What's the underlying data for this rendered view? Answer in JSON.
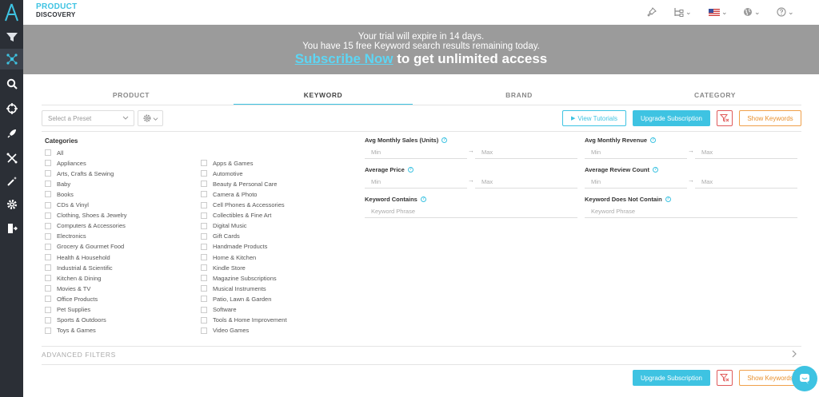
{
  "brand": {
    "line1": "PRODUCT",
    "line2": "DISCOVERY"
  },
  "banner": {
    "line1": "Your trial will expire in 14 days.",
    "line2": "You have 15 free Keyword search results remaining today.",
    "subscribe_link": "Subscribe Now",
    "subscribe_rest": " to get unlimited access"
  },
  "tabs": [
    {
      "label": "PRODUCT",
      "active": false
    },
    {
      "label": "KEYWORD",
      "active": true
    },
    {
      "label": "BRAND",
      "active": false
    },
    {
      "label": "CATEGORY",
      "active": false
    }
  ],
  "toolbar": {
    "preset_placeholder": "Select a Preset",
    "view_tutorials": "View Tutorials",
    "upgrade": "Upgrade Subscription",
    "show_keywords": "Show Keywords"
  },
  "categories": {
    "title": "Categories",
    "all": "All",
    "left": [
      "Appliances",
      "Arts, Crafts & Sewing",
      "Baby",
      "Books",
      "CDs & Vinyl",
      "Clothing, Shoes & Jewelry",
      "Computers & Accessories",
      "Electronics",
      "Grocery & Gourmet Food",
      "Health & Household",
      "Industrial & Scientific",
      "Kitchen & Dining",
      "Movies & TV",
      "Office Products",
      "Pet Supplies",
      "Sports & Outdoors",
      "Toys & Games"
    ],
    "right": [
      "Apps & Games",
      "Automotive",
      "Beauty & Personal Care",
      "Camera & Photo",
      "Cell Phones & Accessories",
      "Collectibles & Fine Art",
      "Digital Music",
      "Gift Cards",
      "Handmade Products",
      "Home & Kitchen",
      "Kindle Store",
      "Magazine Subscriptions",
      "Musical Instruments",
      "Patio, Lawn & Garden",
      "Software",
      "Tools & Home Improvement",
      "Video Games"
    ]
  },
  "filters": {
    "avg_sales": {
      "label": "Avg Monthly Sales (Units)",
      "min": "Min",
      "max": "Max"
    },
    "avg_revenue": {
      "label": "Avg Monthly Revenue",
      "min": "Min",
      "max": "Max"
    },
    "avg_price": {
      "label": "Average Price",
      "min": "Min",
      "max": "Max"
    },
    "avg_reviews": {
      "label": "Average Review Count",
      "min": "Min",
      "max": "Max"
    },
    "kw_contains": {
      "label": "Keyword Contains",
      "placeholder": "Keyword Phrase"
    },
    "kw_not_contain": {
      "label": "Keyword Does Not Contain",
      "placeholder": "Keyword Phrase"
    },
    "arrow": "→",
    "help": "?"
  },
  "advanced_filters": "ADVANCED FILTERS",
  "colors": {
    "accent": "#3ec3e2",
    "sidebar": "#2b2f36",
    "banner": "#9b9b9b",
    "clear": "#e05a5a",
    "show": "#e8902e"
  },
  "icons": [
    "logo-icon",
    "filter-funnel-icon",
    "network-icon",
    "search-icon",
    "crosshair-icon",
    "rocket-icon",
    "split-arrows-icon",
    "magic-wand-icon",
    "gear-icon",
    "logout-icon",
    "pin-icon",
    "hierarchy-icon",
    "us-flag-icon",
    "globe-icon",
    "help-icon",
    "chat-icon"
  ]
}
